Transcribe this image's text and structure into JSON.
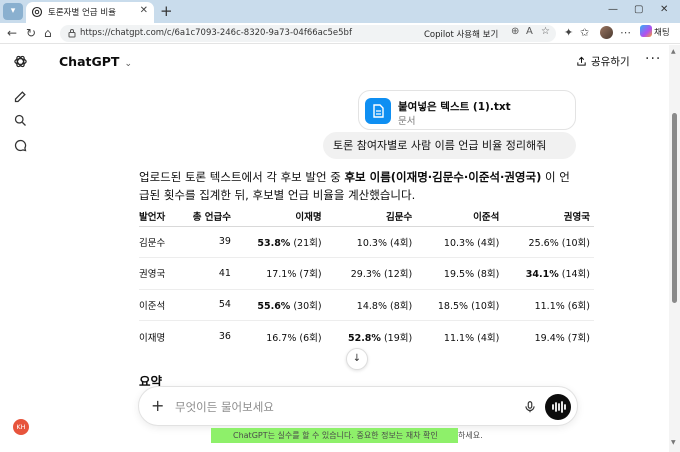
{
  "browser": {
    "tab_title": "토론자별 언급 비율",
    "tab_close": "✕",
    "new_tab": "+",
    "window_controls": [
      "—",
      "▢",
      "✕"
    ],
    "url": "https://chatgpt.com/c/6a1c7093-246c-8320-9a73-04f66ac5e5bf",
    "copilot_label": "Copilot 사용해 보기",
    "chat_label": "채팅"
  },
  "app": {
    "model_name": "ChatGPT",
    "share_label": "공유하기",
    "more_label": "···",
    "user_initials": "KH"
  },
  "conversation": {
    "attachment": {
      "name": "붙여넣은 텍스트 (1).txt",
      "type": "문서"
    },
    "user_message": "토론 참여자별로 사람 이름 언급 비율 정리해줘",
    "answer_intro_a": "업로드된 토론 텍스트에서 각 후보 발언 중 ",
    "answer_intro_bold": "후보 이름(이재명·김문수·이준석·권영국)",
    "answer_intro_b": " 이 언급된 횟수를 집계한 뒤, 후보별 언급 비율을 계산했습니다.",
    "table": {
      "headers": [
        "발언자",
        "총 언급수",
        "이재명",
        "김문수",
        "이준석",
        "권영국"
      ],
      "rows": [
        {
          "speaker": "김문수",
          "total": "39",
          "c1": "53.8%",
          "c1n": " (21회)",
          "c1h": true,
          "c2": "10.3%",
          "c2n": " (4회)",
          "c2h": false,
          "c3": "10.3%",
          "c3n": " (4회)",
          "c3h": false,
          "c4": "25.6%",
          "c4n": " (10회)",
          "c4h": false
        },
        {
          "speaker": "권영국",
          "total": "41",
          "c1": "17.1%",
          "c1n": " (7회)",
          "c1h": false,
          "c2": "29.3%",
          "c2n": " (12회)",
          "c2h": false,
          "c3": "19.5%",
          "c3n": " (8회)",
          "c3h": false,
          "c4": "34.1%",
          "c4n": " (14회)",
          "c4h": true
        },
        {
          "speaker": "이준석",
          "total": "54",
          "c1": "55.6%",
          "c1n": " (30회)",
          "c1h": true,
          "c2": "14.8%",
          "c2n": " (8회)",
          "c2h": false,
          "c3": "18.5%",
          "c3n": " (10회)",
          "c3h": false,
          "c4": "11.1%",
          "c4n": " (6회)",
          "c4h": false
        },
        {
          "speaker": "이재명",
          "total": "36",
          "c1": "16.7%",
          "c1n": " (6회)",
          "c1h": false,
          "c2": "52.8%",
          "c2n": " (19회)",
          "c2h": true,
          "c3": "11.1%",
          "c3n": " (4회)",
          "c3h": false,
          "c4": "19.4%",
          "c4n": " (7회)",
          "c4h": false
        }
      ]
    },
    "summary_heading": "요약"
  },
  "composer": {
    "placeholder": "무엇이든 물어보세요",
    "plus_label": "+",
    "disclaimer_a": "ChatGPT는 실수를 할 수 있습니다. 중요한 정보는 재차 확인",
    "disclaimer_b": "하세요."
  },
  "colors": {
    "accent_blue": "#0f8ff2",
    "highlight_green": "#8ef06a",
    "avatar_red": "#e7543c"
  }
}
